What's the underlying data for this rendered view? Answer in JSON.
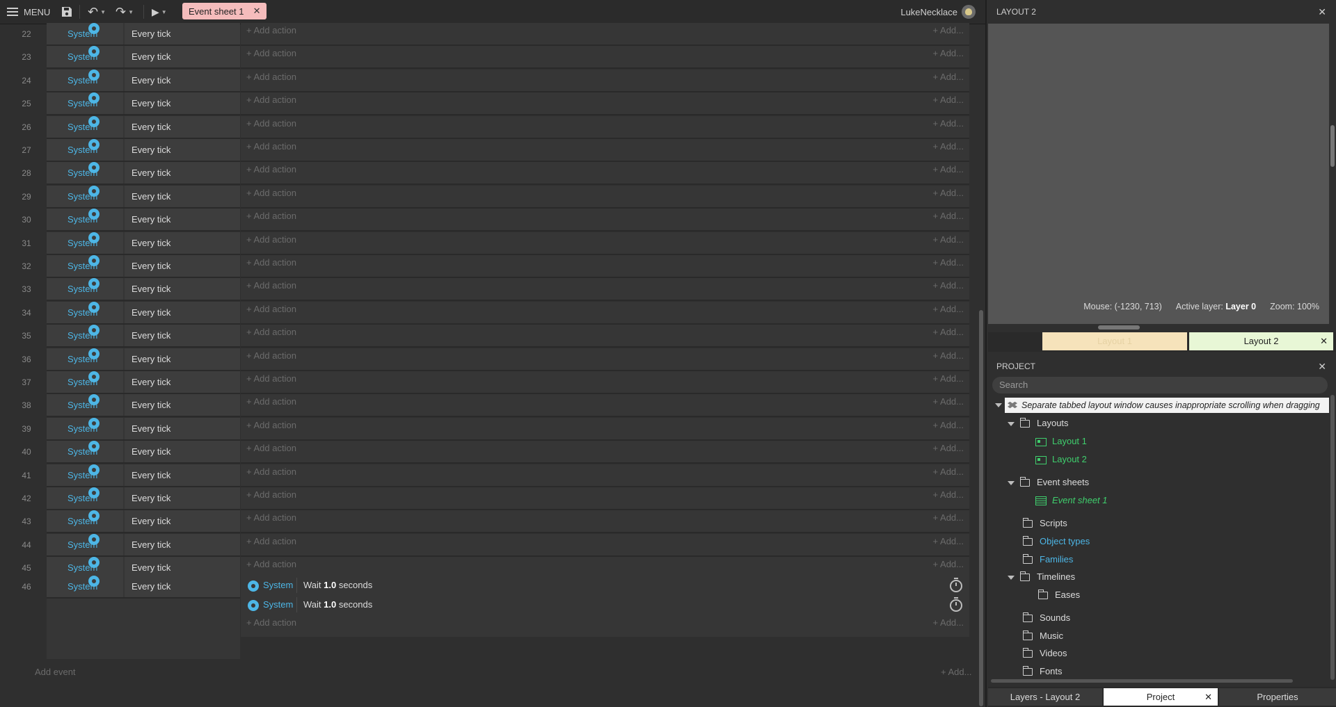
{
  "toolbar": {
    "menu_label": "MENU",
    "tab_label": "Event sheet 1",
    "tab_close": "✕",
    "username": "LukeNecklace"
  },
  "sheet": {
    "rows": [
      {
        "n": "22",
        "object": "System",
        "condition": "Every tick"
      },
      {
        "n": "23",
        "object": "System",
        "condition": "Every tick"
      },
      {
        "n": "24",
        "object": "System",
        "condition": "Every tick"
      },
      {
        "n": "25",
        "object": "System",
        "condition": "Every tick"
      },
      {
        "n": "26",
        "object": "System",
        "condition": "Every tick"
      },
      {
        "n": "27",
        "object": "System",
        "condition": "Every tick"
      },
      {
        "n": "28",
        "object": "System",
        "condition": "Every tick"
      },
      {
        "n": "29",
        "object": "System",
        "condition": "Every tick"
      },
      {
        "n": "30",
        "object": "System",
        "condition": "Every tick"
      },
      {
        "n": "31",
        "object": "System",
        "condition": "Every tick"
      },
      {
        "n": "32",
        "object": "System",
        "condition": "Every tick"
      },
      {
        "n": "33",
        "object": "System",
        "condition": "Every tick"
      },
      {
        "n": "34",
        "object": "System",
        "condition": "Every tick"
      },
      {
        "n": "35",
        "object": "System",
        "condition": "Every tick"
      },
      {
        "n": "36",
        "object": "System",
        "condition": "Every tick"
      },
      {
        "n": "37",
        "object": "System",
        "condition": "Every tick"
      },
      {
        "n": "38",
        "object": "System",
        "condition": "Every tick"
      },
      {
        "n": "39",
        "object": "System",
        "condition": "Every tick"
      },
      {
        "n": "40",
        "object": "System",
        "condition": "Every tick"
      },
      {
        "n": "41",
        "object": "System",
        "condition": "Every tick"
      },
      {
        "n": "42",
        "object": "System",
        "condition": "Every tick"
      },
      {
        "n": "43",
        "object": "System",
        "condition": "Every tick"
      },
      {
        "n": "44",
        "object": "System",
        "condition": "Every tick"
      },
      {
        "n": "45",
        "object": "System",
        "condition": "Every tick"
      }
    ],
    "add_action_label": "+ Add action",
    "add_more_label": "+ Add...",
    "last_event": {
      "n": "46",
      "object": "System",
      "condition": "Every tick",
      "actions": [
        {
          "object": "System",
          "pre": "Wait ",
          "value": "1.0",
          "post": " seconds"
        },
        {
          "object": "System",
          "pre": "Wait ",
          "value": "1.0",
          "post": " seconds"
        }
      ]
    },
    "add_event_label": "Add event",
    "add_event_more": "+ Add..."
  },
  "layout_panel": {
    "title": "LAYOUT 2",
    "close": "✕",
    "mouse_label": "Mouse: (-1230, 713)",
    "active_layer_label": "Active layer: ",
    "active_layer_value": "Layer 0",
    "zoom_label": "Zoom: 100%",
    "tabs": [
      {
        "label": "Layout 1"
      },
      {
        "label": "Layout 2",
        "close": "✕"
      }
    ]
  },
  "project_panel": {
    "title": "PROJECT",
    "close": "✕",
    "search_placeholder": "Search",
    "root": "Separate tabbed layout window causes inappropriate scrolling when dragging",
    "items": {
      "layouts": "Layouts",
      "layout1": "Layout 1",
      "layout2": "Layout 2",
      "event_sheets": "Event sheets",
      "event_sheet1": "Event sheet 1",
      "scripts": "Scripts",
      "object_types": "Object types",
      "families": "Families",
      "timelines": "Timelines",
      "eases": "Eases",
      "sounds": "Sounds",
      "music": "Music",
      "videos": "Videos",
      "fonts": "Fonts"
    }
  },
  "bottom_tabs": {
    "layers": "Layers - Layout 2",
    "project": "Project",
    "project_close": "✕",
    "properties": "Properties"
  },
  "colors": {
    "accent_blue": "#4db6e6",
    "project_green": "#3fcf6d",
    "event_tab_pink": "#f5bcbc",
    "layout1_tab": "#f6e3bb",
    "layout2_tab": "#e8f7d6"
  }
}
